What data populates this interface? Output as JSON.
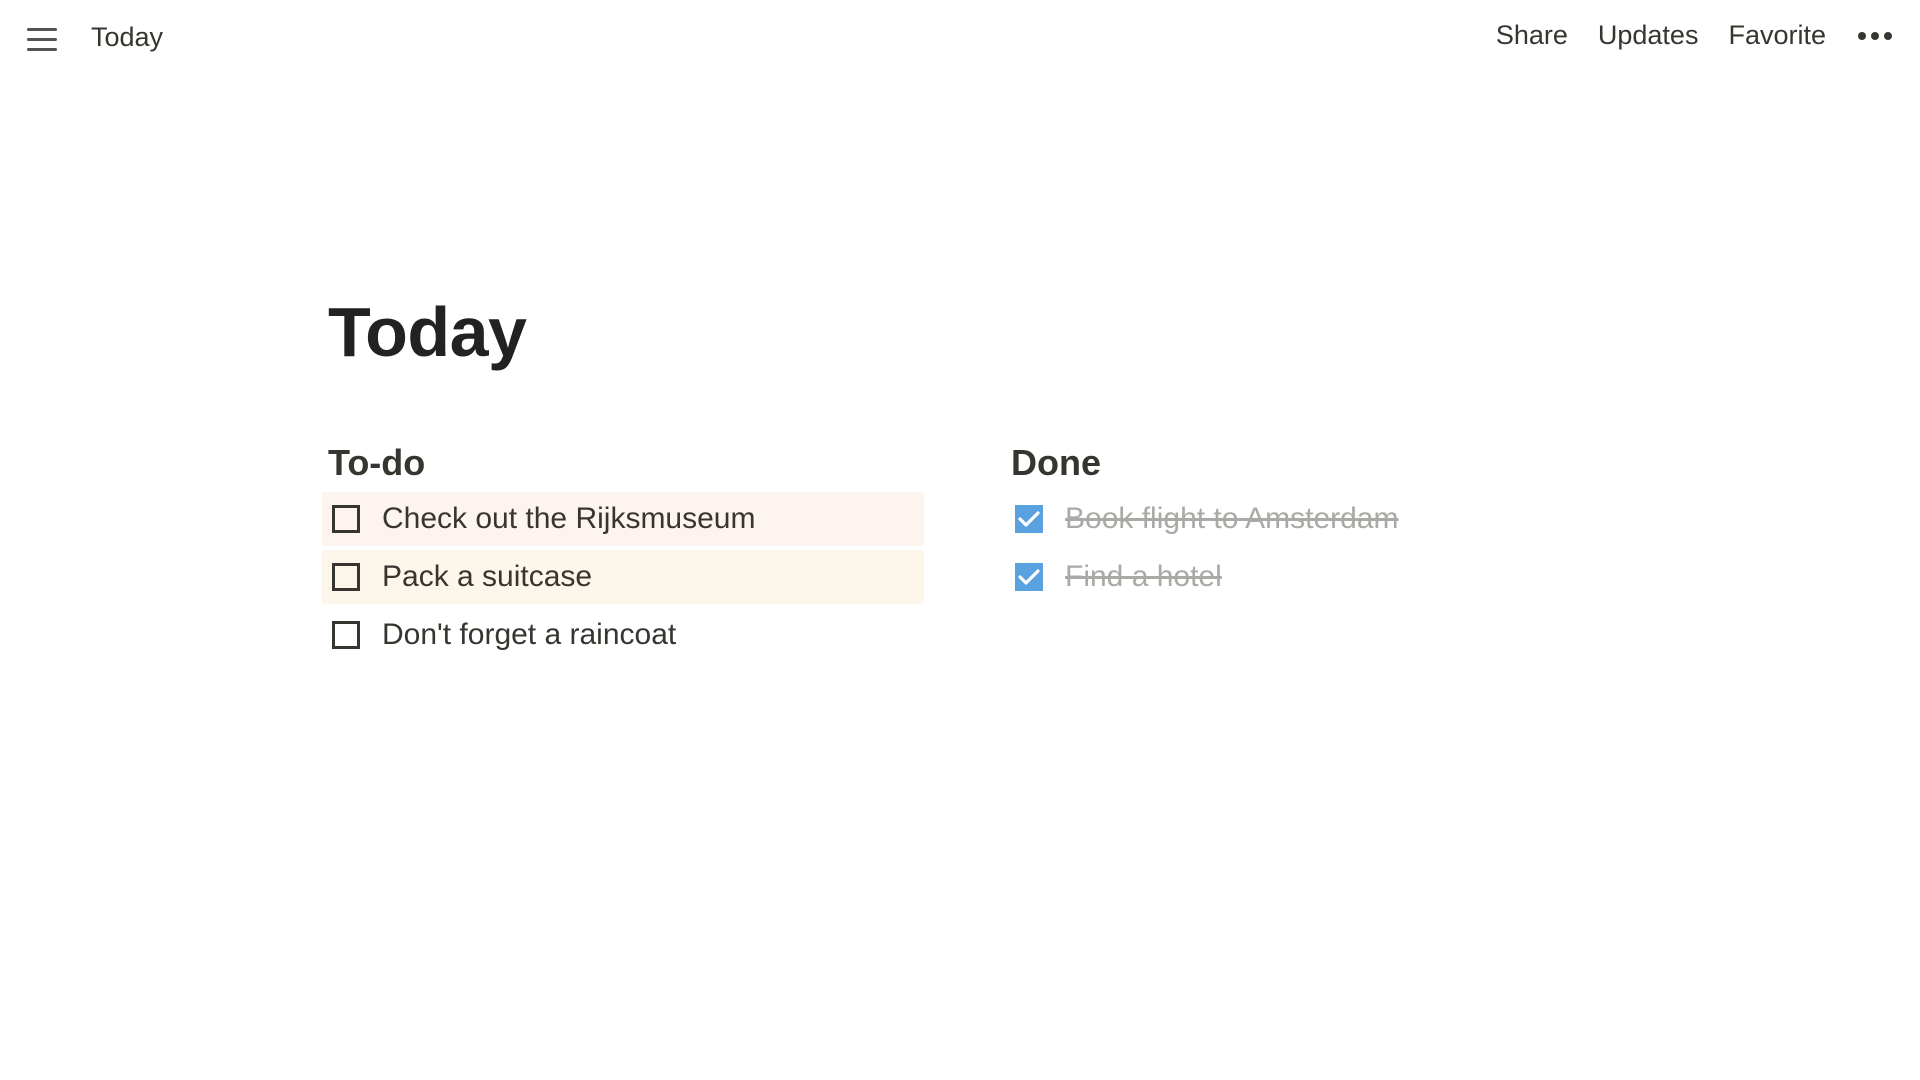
{
  "topbar": {
    "breadcrumb": "Today",
    "actions": {
      "share": "Share",
      "updates": "Updates",
      "favorite": "Favorite"
    }
  },
  "page": {
    "title": "Today"
  },
  "todo": {
    "heading": "To-do",
    "items": [
      {
        "label": "Check out the Rijksmuseum",
        "checked": false
      },
      {
        "label": "Pack a suitcase",
        "checked": false
      },
      {
        "label": "Don't forget a raincoat",
        "checked": false
      }
    ]
  },
  "done": {
    "heading": "Done",
    "items": [
      {
        "label": "Book flight to Amsterdam",
        "checked": true
      },
      {
        "label": "Find a hotel",
        "checked": true
      }
    ]
  },
  "colors": {
    "checkbox_checked": "#5aa1e0",
    "highlight_pink": "#fdf3ef",
    "highlight_cream": "#fdf6ea",
    "done_text": "#a9a9a6"
  }
}
